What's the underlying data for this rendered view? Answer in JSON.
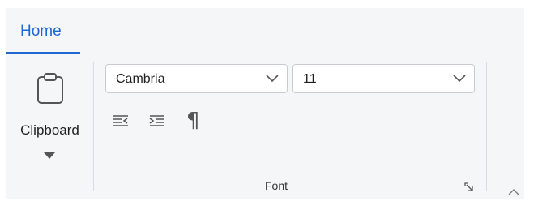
{
  "tabs": [
    {
      "label": "Home",
      "active": true
    }
  ],
  "clipboard": {
    "label": "Clipboard",
    "icon": "clipboard-icon",
    "dropdown_icon": "caret-down-icon"
  },
  "font": {
    "family_value": "Cambria",
    "size_value": "11",
    "group_label": "Font",
    "buttons": [
      {
        "name": "decrease-indent",
        "icon": "decrease-indent-icon"
      },
      {
        "name": "increase-indent",
        "icon": "increase-indent-icon"
      },
      {
        "name": "show-paragraph-marks",
        "icon": "pilcrow-icon",
        "glyph": "¶"
      }
    ],
    "launcher_icon": "dialog-launcher-icon"
  },
  "ribbon": {
    "collapse_icon": "chevron-up-icon"
  },
  "colors": {
    "accent": "#2167d1",
    "background": "#f5f6f8",
    "border": "#c8cbd0"
  }
}
